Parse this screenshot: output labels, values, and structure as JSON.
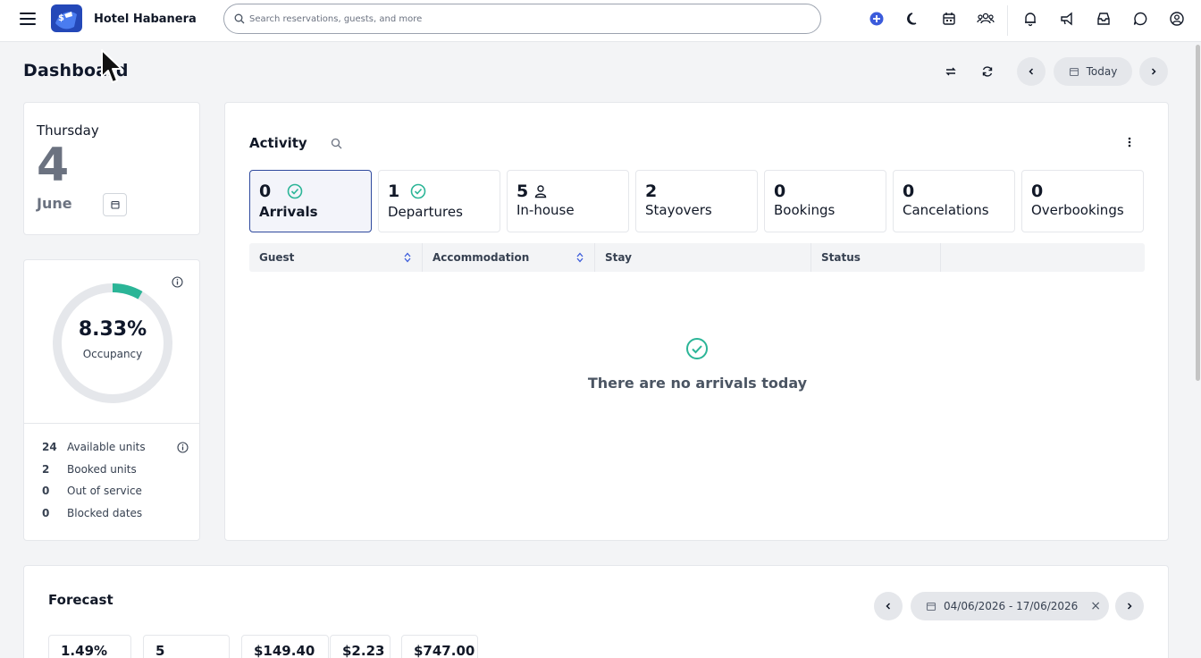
{
  "header": {
    "hotel_name": "Hotel Habanera",
    "search_placeholder": "Search reservations, guests, and more"
  },
  "page": {
    "title": "Dashboard"
  },
  "date_nav": {
    "today_label": "Today"
  },
  "date_card": {
    "day_name": "Thursday",
    "day_number": "4",
    "month": "June"
  },
  "occupancy": {
    "value": "8.33%",
    "fraction": 0.0833,
    "label": "Occupancy",
    "stats": [
      {
        "num": "24",
        "label": "Available units"
      },
      {
        "num": "2",
        "label": "Booked units"
      },
      {
        "num": "0",
        "label": "Out of service"
      },
      {
        "num": "0",
        "label": "Blocked dates"
      }
    ]
  },
  "activity": {
    "title": "Activity",
    "tabs": [
      {
        "count": "0",
        "label": "Arrivals",
        "icon": "check-circle-icon"
      },
      {
        "count": "1",
        "label": "Departures",
        "icon": "check-circle-icon"
      },
      {
        "count": "5",
        "label": "In-house",
        "icon": "person-icon"
      },
      {
        "count": "2",
        "label": "Stayovers"
      },
      {
        "count": "0",
        "label": "Bookings"
      },
      {
        "count": "0",
        "label": "Cancelations"
      },
      {
        "count": "0",
        "label": "Overbookings"
      }
    ],
    "columns": [
      "Guest",
      "Accommodation",
      "Stay",
      "Status"
    ],
    "empty_message": "There are no arrivals today"
  },
  "forecast": {
    "title": "Forecast",
    "range": "04/06/2026 - 17/06/2026",
    "values": [
      "1.49%",
      "5",
      "$149.40",
      "$2.23",
      "$747.00"
    ]
  },
  "colors": {
    "accent": "#2f4a9e",
    "success": "#2bb597",
    "brand_blue": "#3b5bdb"
  }
}
